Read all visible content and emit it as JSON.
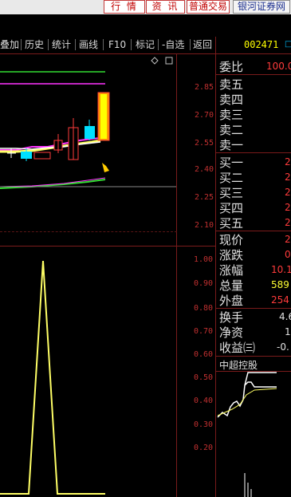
{
  "top_nav": {
    "btn1": "行 情",
    "btn2": "资 讯",
    "btn3": "普通交易",
    "btn4": "银河证券网"
  },
  "toolbar": {
    "items": [
      "叠加",
      "历史",
      "统计",
      "画线",
      "F10",
      "标记",
      "-自选",
      "返回"
    ]
  },
  "stock_code": "002471",
  "code_suffix": "□",
  "kline_axis": [
    "2.85",
    "2.70",
    "2.55",
    "2.40",
    "2.25",
    "2.10"
  ],
  "indicator_axis": [
    "1.00",
    "0.90",
    "0.80",
    "0.70",
    "0.60",
    "0.50",
    "0.40",
    "0.30",
    "0.20"
  ],
  "quote": {
    "weibi_label": "委比",
    "weibi_value": "100.0",
    "sell_labels": [
      "卖五",
      "卖四",
      "卖三",
      "卖二",
      "卖一"
    ],
    "buy_labels": [
      "买一",
      "买二",
      "买三",
      "买四",
      "买五"
    ],
    "buy_values": [
      "2",
      "2",
      "2",
      "2",
      "2"
    ],
    "stats": [
      {
        "label": "现价",
        "value": "2"
      },
      {
        "label": "涨跌",
        "value": "0"
      },
      {
        "label": "涨幅",
        "value": "10.1"
      },
      {
        "label": "总量",
        "value": "589"
      },
      {
        "label": "外盘",
        "value": "254"
      }
    ],
    "stats2": [
      {
        "label": "换手",
        "value": "4.6"
      },
      {
        "label": "净资",
        "value": "1"
      },
      {
        "label": "收益㈢",
        "value": "-0."
      }
    ]
  },
  "mini_chart_title": "中超控股",
  "colors": {
    "up_red": "#ff3b3b",
    "down_cyan": "#00e0ff",
    "ma_yellow": "#ffff66",
    "ma_magenta": "#ff33ff",
    "ma_green": "#33dd33",
    "grid_red": "#7a1b1b"
  }
}
